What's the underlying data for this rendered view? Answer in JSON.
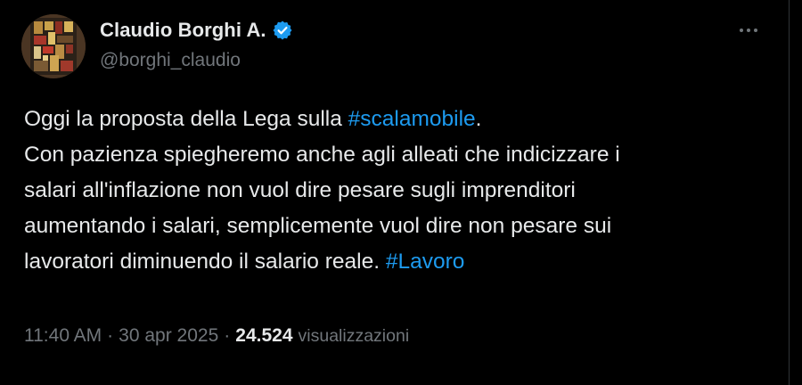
{
  "author": {
    "display_name": "Claudio Borghi A.",
    "handle": "@borghi_claudio"
  },
  "tweet": {
    "text_before_tag1": "Oggi la proposta della Lega sulla ",
    "hashtag1": "#scalamobile",
    "text_after_tag1": ".\nCon pazienza spiegheremo anche agli alleati che indicizzare i\nsalari all'inflazione non vuol dire pesare sugli imprenditori\naumentando i salari, semplicemente vuol dire non pesare sui\nlavoratori diminuendo il salario reale. ",
    "hashtag2": "#Lavoro"
  },
  "meta": {
    "time": "11:40 AM",
    "separator": "·",
    "date": "30 apr 2025",
    "views_count": "24.524",
    "views_label": "visualizzazioni"
  },
  "icons": {
    "verified": "verified-badge-icon",
    "more": "more-options-icon"
  },
  "colors": {
    "background": "#000000",
    "text": "#e7e9ea",
    "muted": "#71767b",
    "accent": "#1d9bf0"
  }
}
